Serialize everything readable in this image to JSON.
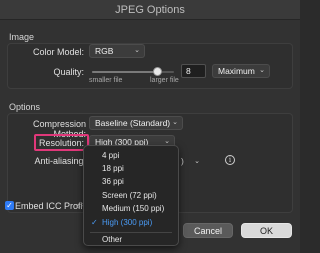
{
  "window": {
    "title": "JPEG Options"
  },
  "image_section": {
    "heading": "Image",
    "color_model": {
      "label": "Color Model:",
      "value": "RGB"
    },
    "quality": {
      "label": "Quality:",
      "value": "8",
      "level_fraction": 0.8,
      "min_label": "smaller file",
      "max_label": "larger file",
      "preset": "Maximum"
    }
  },
  "options_section": {
    "heading": "Options",
    "compression": {
      "label": "Compression Method:",
      "value": "Baseline (Standard)"
    },
    "resolution": {
      "label": "Resolution:",
      "value": "High (300 ppi)"
    },
    "antialiasing": {
      "label": "Anti-aliasing:",
      "value_fragment": ")"
    },
    "embed_icc": {
      "label": "Embed ICC Profile:",
      "fragment": "sR",
      "checked": true
    }
  },
  "resolution_menu": {
    "items": [
      "4 ppi",
      "18 ppi",
      "36 ppi",
      "Screen (72 ppi)",
      "Medium (150 ppi)",
      "High (300 ppi)"
    ],
    "selected_index": 5,
    "other": "Other"
  },
  "buttons": {
    "cancel": "Cancel",
    "ok": "OK"
  },
  "colors": {
    "accent": "#2f7bf5",
    "highlight": "#e0387a",
    "selected_text": "#4a9bf5"
  }
}
